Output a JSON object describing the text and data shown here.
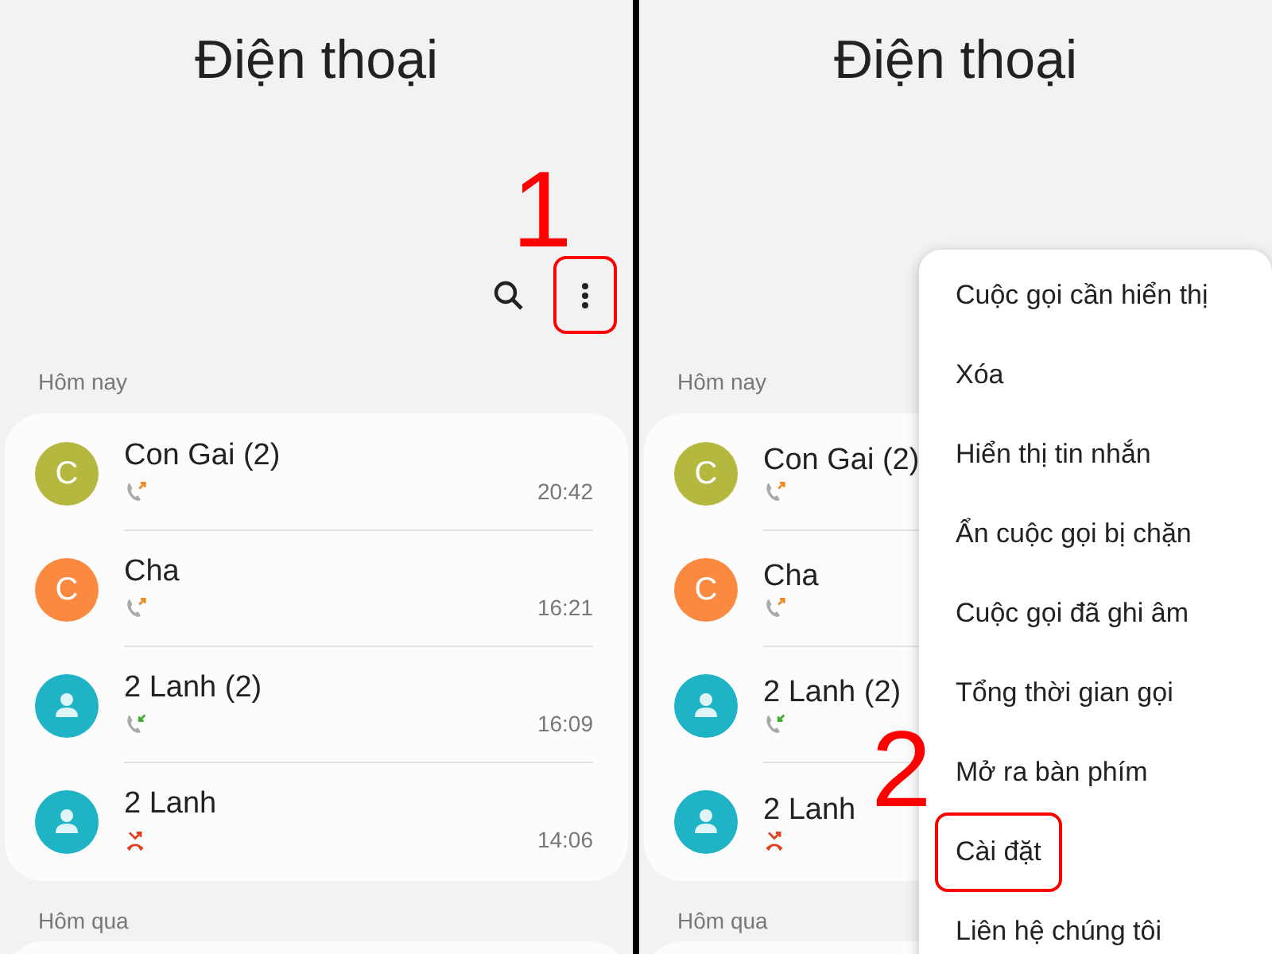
{
  "screens": [
    {
      "title": "Điện thoại",
      "step": "1",
      "toolbar": [
        {
          "kind": "search",
          "highlighted": false
        },
        {
          "kind": "more",
          "highlighted": true
        }
      ],
      "today": "Hôm nay",
      "calls": [
        {
          "name": "Con Gai (2)",
          "time": "20:42",
          "kind": "outgoing",
          "avatar": {
            "kind": "letter",
            "letter": "C",
            "color": "#b5b83f"
          }
        },
        {
          "name": "Cha",
          "time": "16:21",
          "kind": "outgoing",
          "avatar": {
            "kind": "letter",
            "letter": "C",
            "color": "#fb8a40"
          }
        },
        {
          "name": "2 Lanh (2)",
          "time": "16:09",
          "kind": "incoming",
          "avatar": {
            "kind": "person",
            "color": "#1fb3c6"
          }
        },
        {
          "name": "2 Lanh",
          "time": "14:06",
          "kind": "missed",
          "avatar": {
            "kind": "person",
            "color": "#1fb3c6"
          }
        }
      ],
      "yesterday": "Hôm qua"
    },
    {
      "title": "Điện thoại",
      "step": "2",
      "today": "Hôm nay",
      "calls": [
        {
          "name": "Con Gai (2)",
          "kind": "outgoing",
          "avatar": {
            "kind": "letter",
            "letter": "C",
            "color": "#b5b83f"
          }
        },
        {
          "name": "Cha",
          "kind": "outgoing",
          "avatar": {
            "kind": "letter",
            "letter": "C",
            "color": "#fb8a40"
          }
        },
        {
          "name": "2 Lanh (2)",
          "kind": "incoming",
          "avatar": {
            "kind": "person",
            "color": "#1fb3c6"
          }
        },
        {
          "name": "2 Lanh",
          "kind": "missed",
          "avatar": {
            "kind": "person",
            "color": "#1fb3c6"
          }
        }
      ],
      "yesterday": "Hôm qua",
      "menu": [
        {
          "label": "Cuộc gọi cần hiển thị",
          "highlighted": false
        },
        {
          "label": "Xóa",
          "highlighted": false
        },
        {
          "label": "Hiển thị tin nhắn",
          "highlighted": false
        },
        {
          "label": "Ẩn cuộc gọi bị chặn",
          "highlighted": false
        },
        {
          "label": "Cuộc gọi đã ghi âm",
          "highlighted": false
        },
        {
          "label": "Tổng thời gian gọi",
          "highlighted": false
        },
        {
          "label": "Mở ra bàn phím",
          "highlighted": false
        },
        {
          "label": "Cài đặt",
          "highlighted": true
        },
        {
          "label": "Liên hệ chúng tôi",
          "highlighted": false
        }
      ]
    }
  ]
}
